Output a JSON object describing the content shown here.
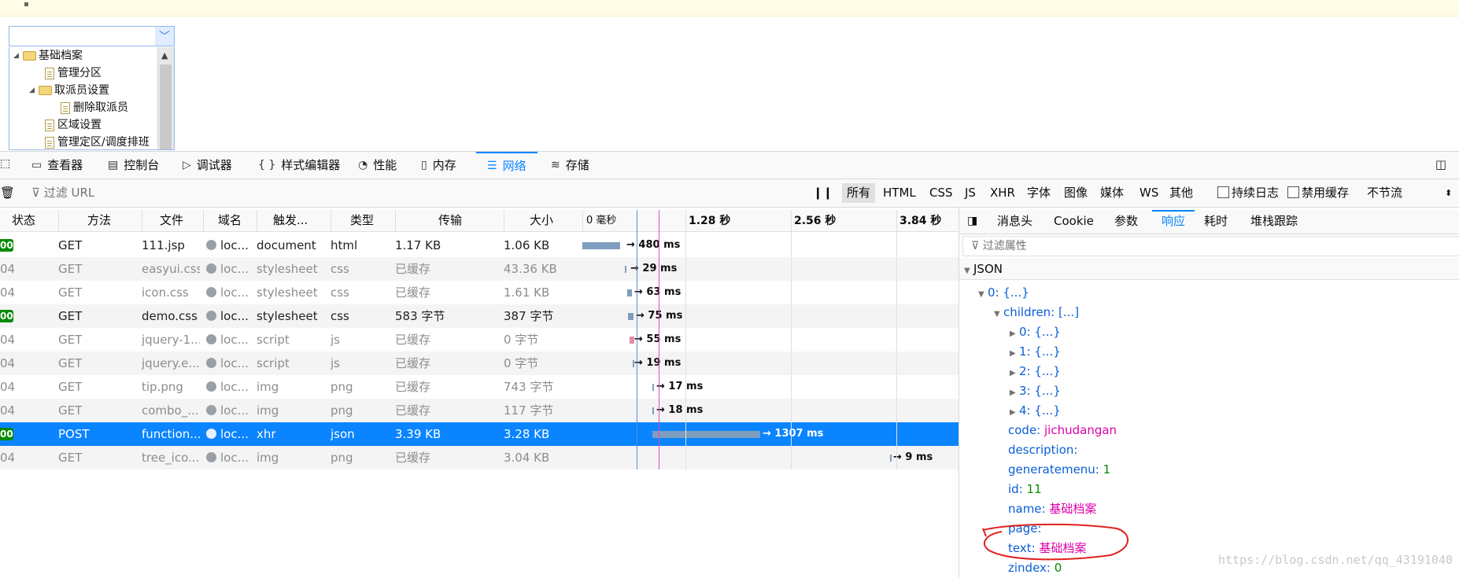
{
  "tree": {
    "items": [
      {
        "label": "基础档案",
        "type": "folder",
        "expanded": true,
        "level": 0
      },
      {
        "label": "管理分区",
        "type": "file",
        "level": 1
      },
      {
        "label": "取派员设置",
        "type": "folder",
        "expanded": true,
        "level": 1
      },
      {
        "label": "删除取派员",
        "type": "file",
        "level": 2
      },
      {
        "label": "区域设置",
        "type": "file",
        "level": 1
      },
      {
        "label": "管理定区/调度排班",
        "type": "file",
        "level": 1
      }
    ]
  },
  "devtools": {
    "tabs": [
      {
        "label": "查看器",
        "icon": "inspector-icon"
      },
      {
        "label": "控制台",
        "icon": "console-icon"
      },
      {
        "label": "调试器",
        "icon": "debugger-icon"
      },
      {
        "label": "样式编辑器",
        "icon": "style-editor-icon"
      },
      {
        "label": "性能",
        "icon": "performance-icon"
      },
      {
        "label": "内存",
        "icon": "memory-icon"
      },
      {
        "label": "网络",
        "icon": "network-icon",
        "active": true
      },
      {
        "label": "存储",
        "icon": "storage-icon"
      }
    ],
    "filter_placeholder": "过滤 URL",
    "type_filters": [
      "所有",
      "HTML",
      "CSS",
      "JS",
      "XHR",
      "字体",
      "图像",
      "媒体",
      "WS",
      "其他"
    ],
    "persist_logs": "持续日志",
    "disable_cache": "禁用缓存",
    "throttle": "不节流"
  },
  "table": {
    "columns": [
      "状态",
      "方法",
      "文件",
      "域名",
      "触发...",
      "类型",
      "传输",
      "大小",
      "0 毫秒"
    ],
    "ticks": [
      "1.28 秒",
      "2.56 秒",
      "3.84 秒"
    ],
    "rows": [
      {
        "status": "00",
        "ok": true,
        "method": "GET",
        "file": "111.jsp",
        "domain": "loc...",
        "cause": "document",
        "type": "html",
        "transferred": "1.17 KB",
        "size": "1.06 KB",
        "timing": "→ 480 ms",
        "cached": false
      },
      {
        "status": "04",
        "ok": false,
        "method": "GET",
        "file": "easyui.css",
        "domain": "loc...",
        "cause": "stylesheet",
        "type": "css",
        "transferred": "已缓存",
        "size": "43.36 KB",
        "timing": "→ 29 ms",
        "cached": true
      },
      {
        "status": "04",
        "ok": false,
        "method": "GET",
        "file": "icon.css",
        "domain": "loc...",
        "cause": "stylesheet",
        "type": "css",
        "transferred": "已缓存",
        "size": "1.61 KB",
        "timing": "→ 63 ms",
        "cached": true
      },
      {
        "status": "00",
        "ok": true,
        "method": "GET",
        "file": "demo.css",
        "domain": "loc...",
        "cause": "stylesheet",
        "type": "css",
        "transferred": "583 字节",
        "size": "387 字节",
        "timing": "→ 75 ms",
        "cached": false
      },
      {
        "status": "04",
        "ok": false,
        "method": "GET",
        "file": "jquery-1...",
        "domain": "loc...",
        "cause": "script",
        "type": "js",
        "transferred": "已缓存",
        "size": "0 字节",
        "timing": "→ 55 ms",
        "cached": true
      },
      {
        "status": "04",
        "ok": false,
        "method": "GET",
        "file": "jquery.e...",
        "domain": "loc...",
        "cause": "script",
        "type": "js",
        "transferred": "已缓存",
        "size": "0 字节",
        "timing": "→ 19 ms",
        "cached": true
      },
      {
        "status": "04",
        "ok": false,
        "method": "GET",
        "file": "tip.png",
        "domain": "loc...",
        "cause": "img",
        "type": "png",
        "transferred": "已缓存",
        "size": "743 字节",
        "timing": "→ 17 ms",
        "cached": true
      },
      {
        "status": "04",
        "ok": false,
        "method": "GET",
        "file": "combo_...",
        "domain": "loc...",
        "cause": "img",
        "type": "png",
        "transferred": "已缓存",
        "size": "117 字节",
        "timing": "→ 18 ms",
        "cached": true
      },
      {
        "status": "00",
        "ok": true,
        "method": "POST",
        "file": "function...",
        "domain": "loc...",
        "cause": "xhr",
        "type": "json",
        "transferred": "3.39 KB",
        "size": "3.28 KB",
        "timing": "→ 1307 ms",
        "cached": false,
        "selected": true
      },
      {
        "status": "04",
        "ok": false,
        "method": "GET",
        "file": "tree_ico...",
        "domain": "loc...",
        "cause": "img",
        "type": "png",
        "transferred": "已缓存",
        "size": "3.04 KB",
        "timing": "→ 9 ms",
        "cached": true
      }
    ]
  },
  "details": {
    "tabs": [
      "消息头",
      "Cookie",
      "参数",
      "响应",
      "耗时",
      "堆栈跟踪"
    ],
    "active_tab": "响应",
    "filter_placeholder": "过滤属性",
    "json_label": "JSON",
    "tree": {
      "root": "0: {...}",
      "children_key": "children:",
      "children_val": "[...]",
      "child_items": [
        "0: {...}",
        "1: {...}",
        "2: {...}",
        "3: {...}",
        "4: {...}"
      ],
      "props": [
        {
          "key": "code:",
          "value": "jichudangan",
          "kind": "str"
        },
        {
          "key": "description:",
          "value": "",
          "kind": "str"
        },
        {
          "key": "generatemenu:",
          "value": "1",
          "kind": "num"
        },
        {
          "key": "id:",
          "value": "11",
          "kind": "num"
        },
        {
          "key": "name:",
          "value": "基础档案",
          "kind": "str"
        },
        {
          "key": "page:",
          "value": "",
          "kind": "str"
        },
        {
          "key": "text:",
          "value": "基础档案",
          "kind": "str"
        },
        {
          "key": "zindex:",
          "value": "0",
          "kind": "num"
        }
      ]
    }
  },
  "watermark": "https://blog.csdn.net/qq_43191040",
  "colors": {
    "accent": "#0a84ff",
    "ok": "#058b00",
    "annotation": "#e0201b"
  }
}
